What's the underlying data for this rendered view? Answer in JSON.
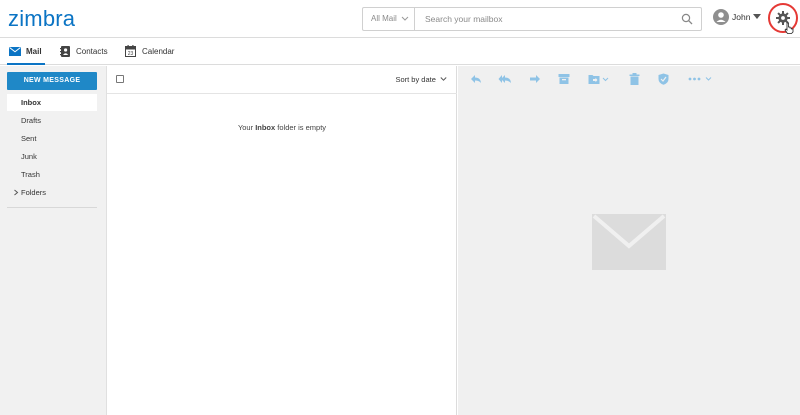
{
  "app": {
    "logo_text": "zimbra",
    "logo_color": "#0b74c4"
  },
  "search": {
    "scope_label": "All Mail",
    "placeholder": "Search your mailbox"
  },
  "user": {
    "name": "John"
  },
  "nav": {
    "tabs": [
      {
        "label": "Mail",
        "icon": "envelope-icon",
        "active": true
      },
      {
        "label": "Contacts",
        "icon": "contacts-icon",
        "active": false
      },
      {
        "label": "Calendar",
        "icon": "calendar-icon",
        "active": false
      }
    ],
    "calendar_day": "23"
  },
  "sidebar": {
    "new_message_label": "NEW MESSAGE",
    "folders": [
      {
        "label": "Inbox",
        "active": true
      },
      {
        "label": "Drafts"
      },
      {
        "label": "Sent"
      },
      {
        "label": "Junk"
      },
      {
        "label": "Trash"
      },
      {
        "label": "Folders",
        "expandable": true
      }
    ]
  },
  "list": {
    "sort_label": "Sort by date",
    "empty_prefix": "Your",
    "empty_folder": "Inbox",
    "empty_suffix": "folder is empty"
  },
  "reader": {
    "toolbar_icons": [
      "reply-icon",
      "reply-all-icon",
      "forward-icon",
      "archive-icon",
      "move-to-folder-icon",
      "delete-icon",
      "spam-shield-icon",
      "more-icon"
    ]
  },
  "colors": {
    "accent": "#0b74c4",
    "button": "#1f88c7",
    "toolbar_icon": "#8fc3e6",
    "highlight_ring": "#e53935"
  }
}
